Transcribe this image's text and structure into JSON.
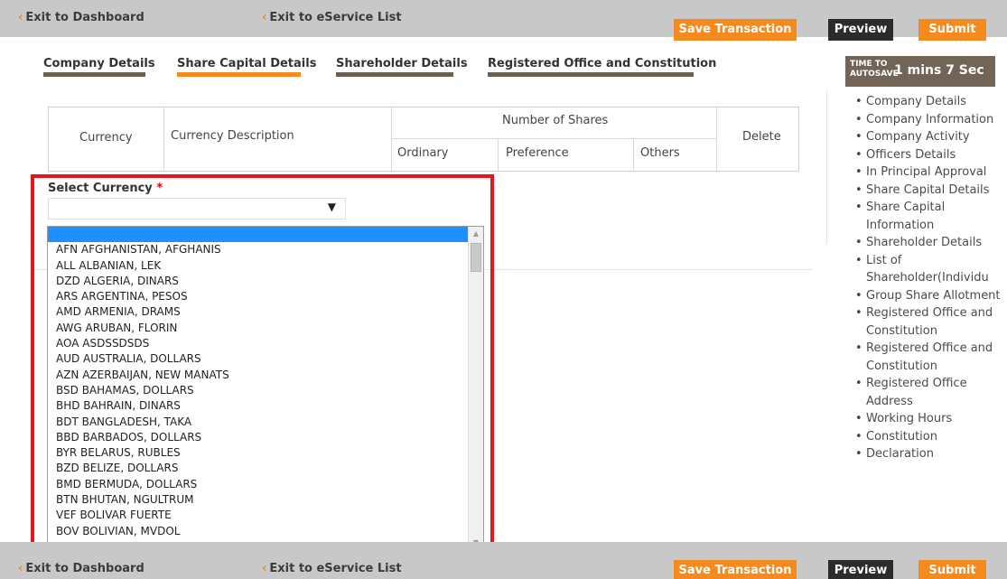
{
  "topbar": {
    "exit_dashboard": "Exit to Dashboard",
    "exit_eservice": "Exit to eService List",
    "save": "Save Transaction",
    "preview": "Preview",
    "submit": "Submit"
  },
  "tabs": [
    {
      "label": "Company Details"
    },
    {
      "label": "Share Capital Details"
    },
    {
      "label": "Shareholder Details"
    },
    {
      "label": "Registered Office and Constitution"
    }
  ],
  "autosave": {
    "label_line1": "TIME TO",
    "label_line2": "AUTOSAVE",
    "value": "1 mins  7 Sec"
  },
  "table": {
    "currency": "Currency",
    "currency_description": "Currency Description",
    "number_of_shares": "Number of Shares",
    "ordinary": "Ordinary",
    "preference": "Preference",
    "others": "Others",
    "delete": "Delete"
  },
  "select": {
    "label": "Select Currency",
    "required_mark": "*",
    "value": "",
    "arrow": "▼"
  },
  "currencies": [
    "",
    "AFN AFGHANISTAN, AFGHANIS",
    "ALL ALBANIAN, LEK",
    "DZD ALGERIA, DINARS",
    "ARS ARGENTINA, PESOS",
    "AMD ARMENIA, DRAMS",
    "AWG ARUBAN, FLORIN",
    "AOA ASDSSDSDS",
    "AUD AUSTRALIA, DOLLARS",
    "AZN AZERBAIJAN, NEW MANATS",
    "BSD BAHAMAS, DOLLARS",
    "BHD BAHRAIN, DINARS",
    "BDT BANGLADESH, TAKA",
    "BBD BARBADOS, DOLLARS",
    "BYR BELARUS, RUBLES",
    "BZD BELIZE, DOLLARS",
    "BMD BERMUDA, DOLLARS",
    "BTN BHUTAN, NGULTRUM",
    "VEF BOLIVAR FUERTE",
    "BOV BOLIVIAN, MVDOL"
  ],
  "right_nav": [
    "Company Details",
    "Company Information",
    "Company Activity",
    "Officers Details",
    "In Principal Approval",
    "Share Capital Details",
    "Share Capital Information",
    "Shareholder Details",
    "List of Shareholder(Individu",
    "Group Share Allotment",
    "Registered Office and Constitution",
    "Registered Office and Constitution",
    "Registered Office Address",
    "Working Hours",
    "Constitution",
    "Declaration"
  ],
  "colors": {
    "accent": "#f58a1f",
    "dark_button": "#2b2b2b",
    "bar": "#c8c8c8",
    "highlight": "#e8141b",
    "selected_option": "#1e90ff"
  }
}
